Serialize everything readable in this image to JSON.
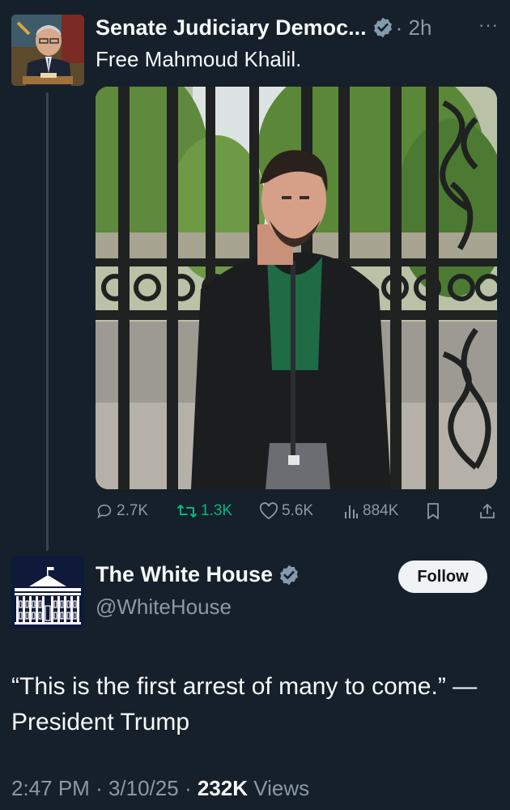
{
  "parent_tweet": {
    "display_name": "Senate Judiciary Democ...",
    "time": "· 2h",
    "more": "···",
    "text": "Free Mahmoud Khalil.",
    "avatar_icon": "senator-portrait",
    "media_icon": "man-in-front-of-iron-gate-photo",
    "actions": {
      "replies": "2.7K",
      "reposts": "1.3K",
      "likes": "5.6K",
      "views": "884K"
    }
  },
  "main_tweet": {
    "display_name": "The White House",
    "handle": "@WhiteHouse",
    "follow_label": "Follow",
    "avatar_icon": "white-house-logo",
    "text": "“This is the first arrest of many to come.” —President Trump",
    "time": "2:47 PM",
    "date": "3/10/25",
    "view_count": "232K",
    "views_label": "Views"
  },
  "colors": {
    "background": "#15202b",
    "text": "#f7f9f9",
    "muted": "#8b98a5",
    "verified": "#829aab",
    "repost_active": "#00ba7c"
  }
}
